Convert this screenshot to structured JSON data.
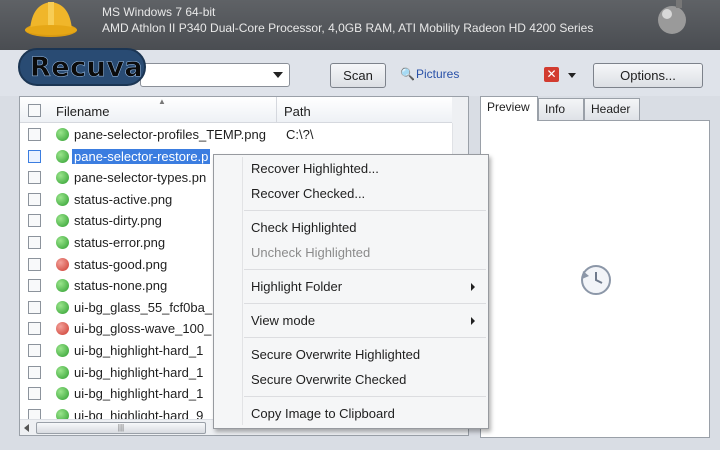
{
  "app": {
    "brand": "Recuva",
    "sysinfo_line1": "MS Windows 7 64-bit",
    "sysinfo_line2": "AMD Athlon II P340 Dual-Core Processor, 4,0GB RAM, ATI Mobility Radeon HD 4200 Series"
  },
  "toolbar": {
    "scan_label": "Scan",
    "filter_value": "Pictures",
    "options_label": "Options..."
  },
  "list": {
    "col_filename": "Filename",
    "col_path": "Path",
    "rows": [
      {
        "name": "pane-selector-profiles_TEMP.png",
        "path": "C:\\?\\",
        "state": "green"
      },
      {
        "name": "pane-selector-restore.p",
        "path": "",
        "state": "green"
      },
      {
        "name": "pane-selector-types.pn",
        "path": "",
        "state": "green"
      },
      {
        "name": "status-active.png",
        "path": "",
        "state": "green"
      },
      {
        "name": "status-dirty.png",
        "path": "",
        "state": "green"
      },
      {
        "name": "status-error.png",
        "path": "",
        "state": "green"
      },
      {
        "name": "status-good.png",
        "path": "",
        "state": "red"
      },
      {
        "name": "status-none.png",
        "path": "",
        "state": "green"
      },
      {
        "name": "ui-bg_glass_55_fcf0ba_",
        "path": "",
        "state": "green"
      },
      {
        "name": "ui-bg_gloss-wave_100_",
        "path": "",
        "state": "red"
      },
      {
        "name": "ui-bg_highlight-hard_1",
        "path": "",
        "state": "green"
      },
      {
        "name": "ui-bg_highlight-hard_1",
        "path": "",
        "state": "green"
      },
      {
        "name": "ui-bg_highlight-hard_1",
        "path": "",
        "state": "green"
      },
      {
        "name": "ui-bg_highlight-hard_9",
        "path": "",
        "state": "green"
      }
    ]
  },
  "preview": {
    "tabs": [
      "Preview",
      "Info",
      "Header"
    ]
  },
  "context_menu": {
    "recover_highlighted": "Recover Highlighted...",
    "recover_checked": "Recover Checked...",
    "check_highlighted": "Check Highlighted",
    "uncheck_highlighted": "Uncheck Highlighted",
    "highlight_folder": "Highlight Folder",
    "view_mode": "View mode",
    "secure_overwrite_highlighted": "Secure Overwrite Highlighted",
    "secure_overwrite_checked": "Secure Overwrite Checked",
    "copy_image": "Copy Image to Clipboard"
  },
  "colors": {
    "selection": "#3b7de0",
    "status_green": "#2f9e30",
    "status_red": "#cc3b2f"
  }
}
